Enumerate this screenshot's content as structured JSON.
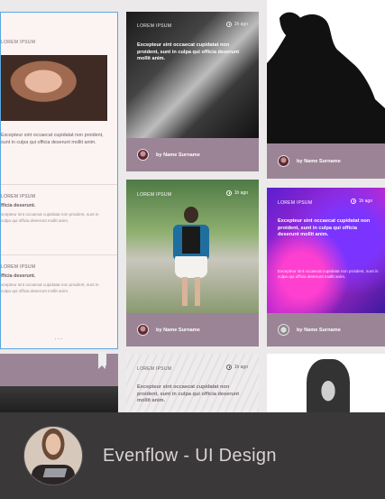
{
  "cards": {
    "list": {
      "top_tag": "LOREM IPSUM",
      "top_excerpt": "Excepteur sint occaecat cupidatat non proident, sunt in culpa qui officia deserunt mollit anim.",
      "rows": [
        {
          "tag": "LOREM IPSUM",
          "title": "fficia deserunt.",
          "text": "xcepteur sint occaecat cupidatat non proident, sunt in culpa qui officia deserunt mollit anim."
        },
        {
          "tag": "LOREM IPSUM",
          "title": "fficia deserunt.",
          "text": "xcepteur sint occaecat cupidatat non proident, sunt in culpa qui officia deserunt mollit anim."
        }
      ],
      "more": "..."
    },
    "dj": {
      "tag": "LOREM IPSUM",
      "time": "1h ago",
      "excerpt": "Excepteur sint occaecat cupidatat non proident, sunt in culpa qui officia deserunt mollit anim.",
      "author": "by Name Surname"
    },
    "singer": {
      "author": "by Name Surname"
    },
    "girl": {
      "tag": "LOREM IPSUM",
      "time": "1h ago",
      "author": "by Name Surname"
    },
    "purple": {
      "tag": "LOREM IPSUM",
      "time": "1h ago",
      "excerpt": "Excepteur sint occaecat cupidatat non proident, sunt in culpa qui officia deserunt mollit anim.",
      "small": "Excepteur sint occaecat cupidatat non proident, sunt in culpa qui officia deserunt mollit anim.",
      "author": "by Name Surname"
    },
    "paper": {
      "tag": "LOREM IPSUM",
      "time": "1h ago",
      "excerpt": "Excepteur sint occaecat cupidatat non proident, sunt in culpa qui officia deserunt mollit anim."
    }
  },
  "footer": {
    "caption": "Evenflow - UI Design"
  },
  "colors": {
    "accent": "#9c8497",
    "panel": "#3b3839",
    "selection": "#5aa7e0"
  }
}
